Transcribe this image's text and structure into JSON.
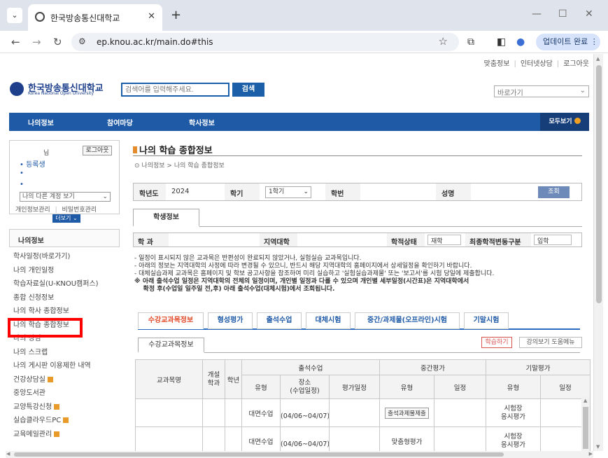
{
  "browser": {
    "tab_title": "한국방송통신대학교",
    "new_tab": "+",
    "url": "ep.knou.ac.kr/main.do#this",
    "update_label": "업데이트 완료"
  },
  "util_links": [
    "맞춤정보",
    "인터넷상담",
    "로그아웃"
  ],
  "header": {
    "logo_kr": "한국방송통신대학교",
    "logo_en": "Korea National Open University",
    "search_placeholder": "검색어를 입력해주세요.",
    "search_button": "검색",
    "shortcut": "바로가기"
  },
  "gnb": {
    "items": [
      "나의정보",
      "참여마당",
      "학사정보"
    ],
    "all_label": "모두보기"
  },
  "user": {
    "name_suffix": "님",
    "logout": "로그아웃",
    "lines": [
      "• 등록생",
      "•",
      "•"
    ],
    "account_select": "나의 다른 계정 보기",
    "link_personal": "개인정보관리",
    "link_password": "비밀번호관리",
    "more": "더보기"
  },
  "lnb": {
    "title": "나의정보",
    "items": [
      {
        "label": "학사일정(바로가기)",
        "plus": false
      },
      {
        "label": "나의 개인일정",
        "plus": false
      },
      {
        "label": "학습자료실(U-KNOU캠퍼스)",
        "plus": false
      },
      {
        "label": "종합 신청정보",
        "plus": false
      },
      {
        "label": "나의 학사 종합정보",
        "plus": false
      },
      {
        "label": "나의 학습 종합정보",
        "plus": false
      },
      {
        "label": "나의 상담",
        "plus": false
      },
      {
        "label": "나의 스크랩",
        "plus": false
      },
      {
        "label": "나의 게시판 이용제한 내역",
        "plus": false
      },
      {
        "label": "건강상담실",
        "plus": true
      },
      {
        "label": "중앙도서관",
        "plus": false
      },
      {
        "label": "교양특강신청",
        "plus": true
      },
      {
        "label": "실습클라우드PC",
        "plus": true
      },
      {
        "label": "교육메일관리",
        "plus": true
      }
    ]
  },
  "main": {
    "title": "나의 학습 종합정보",
    "breadcrumb_home": "나의정보",
    "breadcrumb_sep": ">",
    "breadcrumb_current": "나의 학습 종합정보"
  },
  "filter": {
    "year_label": "학년도",
    "year_value": "2024",
    "semester_label": "학기",
    "semester_value": "1학기",
    "student_no_label": "학번",
    "name_label": "성명",
    "search_button": "조회"
  },
  "student_tab": "학생정보",
  "info": {
    "dept_label": "학 과",
    "region_label": "지역대학",
    "status_label": "학적상태",
    "status_value": "재학",
    "final_label": "최종학적변동구분",
    "final_value": "입학"
  },
  "notes": [
    "- 일정이 표시되지 않은 교과목은 반편성이 완료되지 않았거나, 실험실습 교과목입니다.",
    "- 아래의 정보는 지역대학의 사정에 따라 변경될 수 있으니, 반드시 해당 지역대학의 홈페이지에서 상세일정을 확인하기 바랍니다.",
    "- 대체실습과제 교과목은 홈페이지 및 학보 공고사항을 참조하여 미리 실습하고 '실험실습과제물' 또는 '보고서'를 시험 당일에 제출합니다.",
    "※ 아래 출석수업 일정은 지역대학의 전체의 일정이며, 개인별 일정과 다를 수 있으며 개인별 세부일정(시간표)은 지역대학에서",
    "    확정 후(수업일 일주일 전,후) 아래 출석수업(대체시험)에서 조회됩니다."
  ],
  "tabs": [
    "수강교과목정보",
    "형성평가",
    "출석수업",
    "대체시험",
    "중간/과제물(오프라인)시험",
    "기말시험"
  ],
  "subtab": "수강교과목정보",
  "buttons": {
    "learn": "학습하기",
    "help": "강의보기 도움메뉴"
  },
  "table": {
    "h_course": "교과목명",
    "h_year_open": "개설\n학과",
    "h_grade": "학년",
    "h_attend": "출석수업",
    "h_mid": "중간평가",
    "h_final": "기말평가",
    "h_type": "유형",
    "h_place": "장소\n(수업일정)",
    "h_eval": "평가일정",
    "h_mid_type": "유형",
    "h_mid_date": "일정",
    "h_final_type": "유형",
    "h_final_date": "일정",
    "rows": [
      {
        "attend_type": "대면수업",
        "place": "(04/06~04/07)",
        "mid_type": "출석과제물제출",
        "mid_is_button": true,
        "final_type": "시험장\n응시평가"
      },
      {
        "attend_type": "대면수업",
        "place": "(04/06~04/07)",
        "mid_type": "맞춤형평가",
        "mid_is_button": false,
        "final_type": "시험장\n응시평가"
      }
    ]
  }
}
